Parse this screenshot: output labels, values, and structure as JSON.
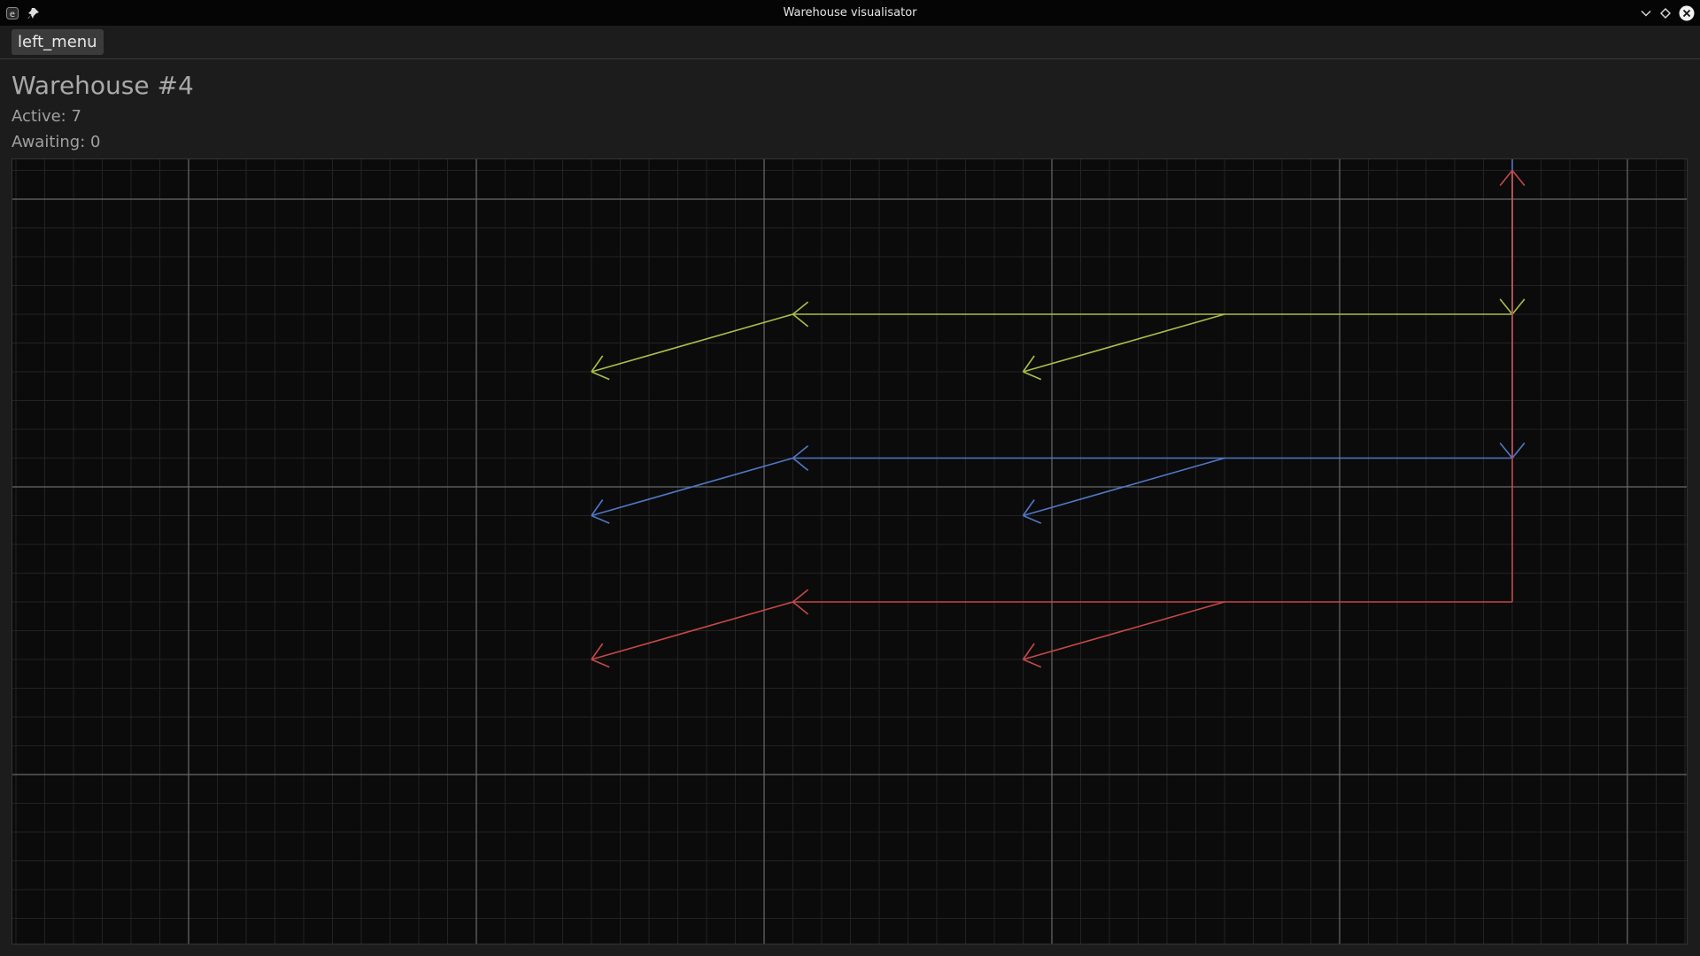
{
  "window": {
    "title": "Warehouse visualisator",
    "app_icon": "e-app-icon",
    "pin_icon": "pin-icon",
    "controls": [
      "chevron-down-icon",
      "diamond-icon",
      "close-icon"
    ]
  },
  "menu": {
    "left_menu_label": "left_menu"
  },
  "warehouse": {
    "title": "Warehouse #4",
    "active_label": "Active: 7",
    "awaiting_label": "Awaiting: 0"
  },
  "colors": {
    "background": "#1c1c1c",
    "canvas": "#0b0b0b",
    "grid_minor": "#232323",
    "grid_major": "#6a6a6a",
    "route_yellow": "#a8c04a",
    "route_blue": "#4f79c6",
    "route_red": "#c64848"
  },
  "grid": {
    "columns": 58,
    "rows": 27
  },
  "routes": [
    {
      "color": "route_yellow",
      "segments": [
        [
          46,
          21,
          46,
          16
        ],
        [
          46,
          16,
          21,
          16
        ],
        [
          36,
          16,
          29,
          14
        ],
        [
          21,
          16,
          14,
          14
        ]
      ]
    },
    {
      "color": "route_blue",
      "segments": [
        [
          46,
          26,
          46,
          11
        ],
        [
          46,
          11,
          21,
          11
        ],
        [
          36,
          11,
          29,
          9
        ],
        [
          21,
          11,
          14,
          9
        ]
      ]
    },
    {
      "color": "route_red",
      "segments": [
        [
          46,
          6,
          46,
          21
        ],
        [
          46,
          6,
          21,
          6
        ],
        [
          36,
          6,
          29,
          4
        ],
        [
          21,
          6,
          14,
          4
        ]
      ]
    }
  ]
}
